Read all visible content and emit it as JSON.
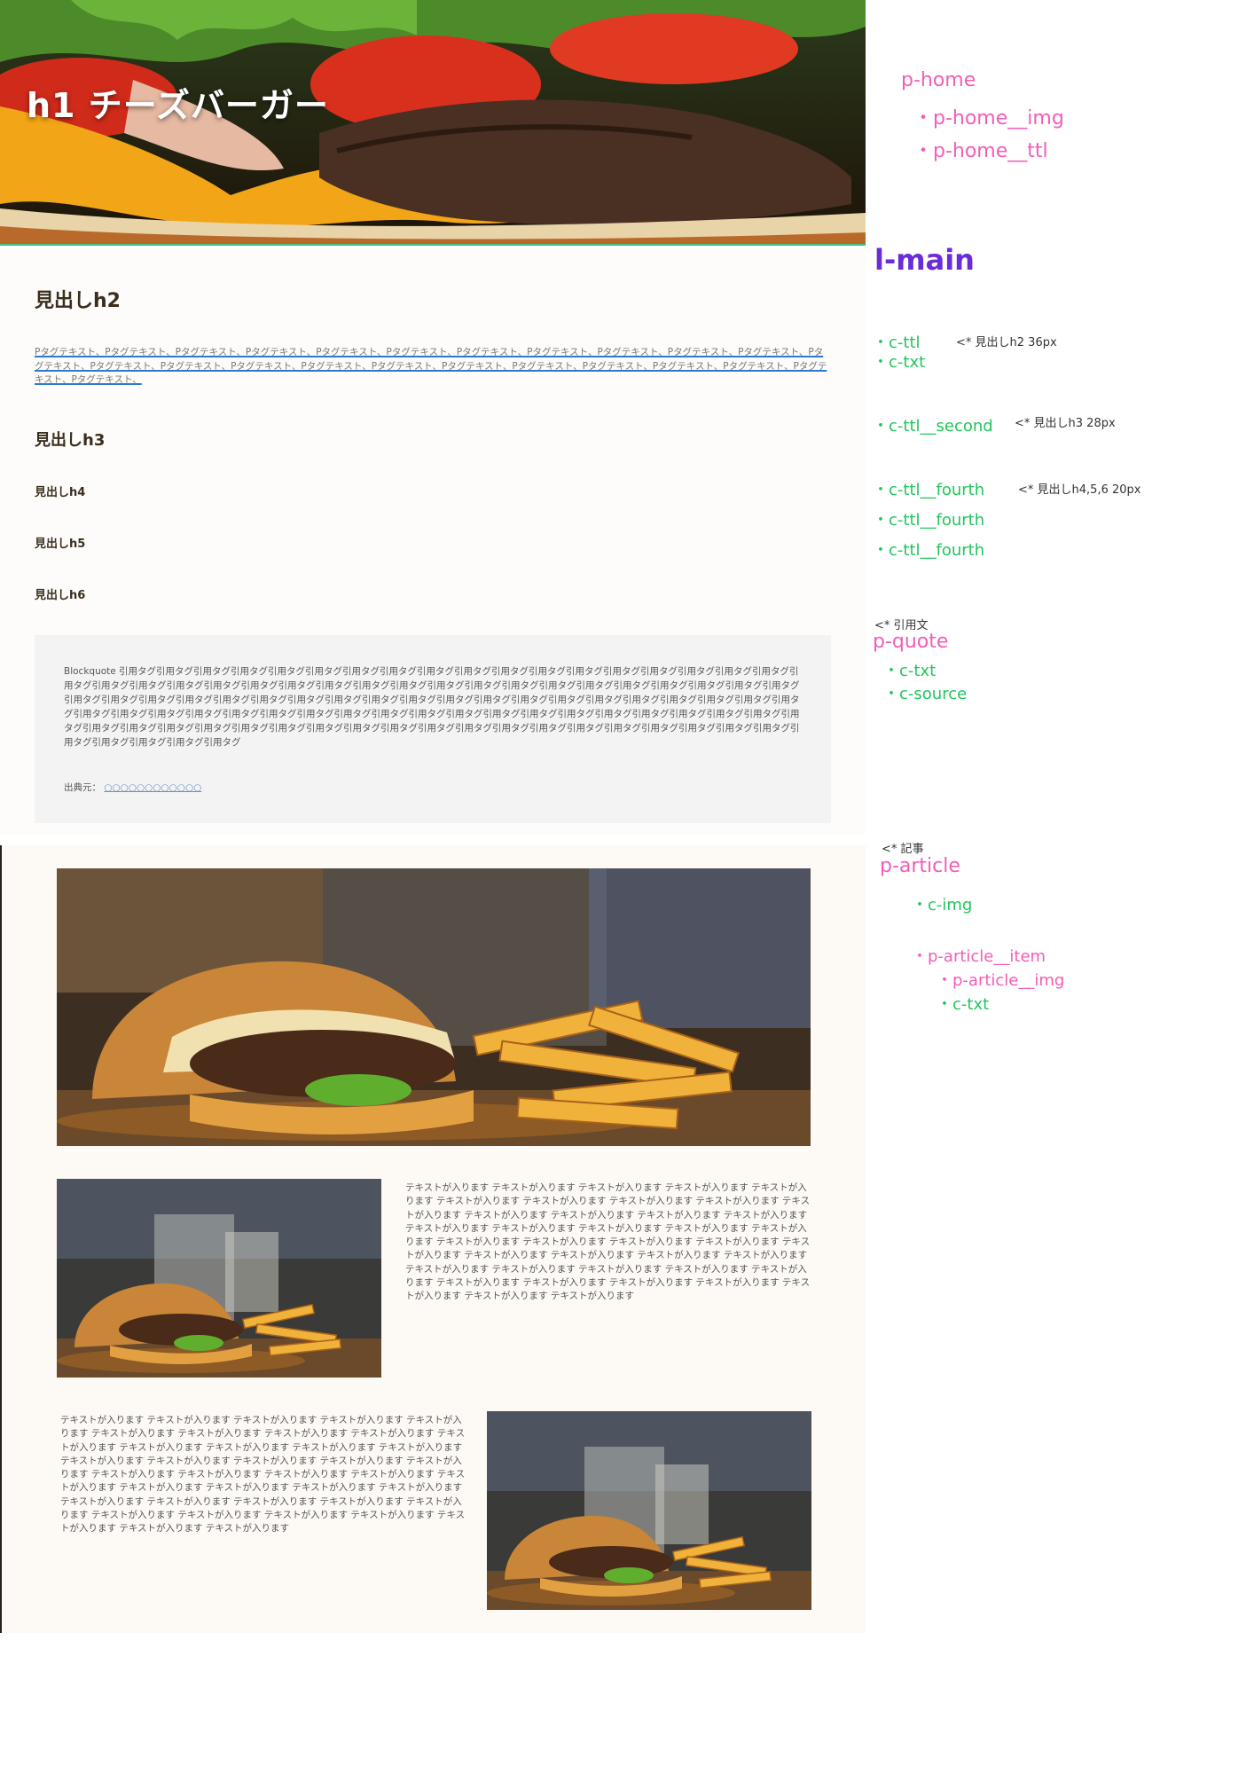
{
  "hero": {
    "title": "h1 チーズバーガー"
  },
  "main": {
    "h2": "見出しh2",
    "link_text": "Pタグテキスト、Pタグテキスト、Pタグテキスト、Pタグテキスト、Pタグテキスト、Pタグテキスト、Pタグテキスト、Pタグテキスト、Pタグテキスト、Pタグテキスト、Pタグテキスト、Pタグテキスト、Pタグテキスト、Pタグテキスト、Pタグテキスト、Pタグテキスト、Pタグテキスト、Pタグテキスト、Pタグテキスト、Pタグテキスト、Pタグテキスト、Pタグテキスト、Pタグテキスト、Pタグテキスト、",
    "h3": "見出しh3",
    "h4": "見出しh4",
    "h5": "見出しh5",
    "h6": "見出しh6",
    "quote_text": "Blockquote 引用タグ引用タグ引用タグ引用タグ引用タグ引用タグ引用タグ引用タグ引用タグ引用タグ引用タグ引用タグ引用タグ引用タグ引用タグ引用タグ引用タグ引用タグ引用タグ引用タグ引用タグ引用タグ引用タグ引用タグ引用タグ引用タグ引用タグ引用タグ引用タグ引用タグ引用タグ引用タグ引用タグ引用タグ引用タグ引用タグ引用タグ引用タグ引用タグ引用タグ引用タグ引用タグ引用タグ引用タグ引用タグ引用タグ引用タグ引用タグ引用タグ引用タグ引用タグ引用タグ引用タグ引用タグ引用タグ引用タグ引用タグ引用タグ引用タグ引用タグ引用タグ引用タグ引用タグ引用タグ引用タグ引用タグ引用タグ引用タグ引用タグ引用タグ引用タグ引用タグ引用タグ引用タグ引用タグ引用タグ引用タグ引用タグ引用タグ引用タグ引用タグ引用タグ引用タグ引用タグ引用タグ引用タグ引用タグ引用タグ引用タグ引用タグ引用タグ引用タグ引用タグ引用タグ引用タグ引用タグ引用タグ引用タグ引用タグ引用タグ引用タグ引用タグ",
    "quote_source_label": "出典元：",
    "quote_source_link": "○○○○○○○○○○○○"
  },
  "article": {
    "text_right": "テキストが入ります テキストが入ります テキストが入ります テキストが入ります テキストが入ります テキストが入ります テキストが入ります テキストが入ります テキストが入ります テキストが入ります テキストが入ります テキストが入ります テキストが入ります テキストが入ります テキストが入ります テキストが入ります テキストが入ります テキストが入ります テキストが入ります テキストが入ります テキストが入ります テキストが入ります テキストが入ります テキストが入ります テキストが入ります テキストが入ります テキストが入ります テキストが入ります テキストが入ります テキストが入ります テキストが入ります テキストが入ります テキストが入ります テキストが入ります テキストが入ります テキストが入ります テキストが入ります テキストが入ります テキストが入ります テキストが入ります",
    "text_left": "テキストが入ります テキストが入ります テキストが入ります テキストが入ります テキストが入ります テキストが入ります テキストが入ります テキストが入ります テキストが入ります テキストが入ります テキストが入ります テキストが入ります テキストが入ります テキストが入ります テキストが入ります テキストが入ります テキストが入ります テキストが入ります テキストが入ります テキストが入ります テキストが入ります テキストが入ります テキストが入ります テキストが入ります テキストが入ります テキストが入ります テキストが入ります テキストが入ります テキストが入ります テキストが入ります テキストが入ります テキストが入ります テキストが入ります テキストが入ります テキストが入ります テキストが入ります テキストが入ります テキストが入ります テキストが入ります テキストが入ります"
  },
  "annotations": {
    "p_home": "p-home",
    "p_home_img": "・p-home__img",
    "p_home_ttl": "・p-home__ttl",
    "l_main": "l-main",
    "c_ttl": "・c-ttl",
    "c_ttl_note": "<* 見出しh2  36px",
    "c_txt": "・c-txt",
    "c_ttl_second": "・c-ttl__second",
    "c_ttl_second_note": "<* 見出しh3  28px",
    "c_ttl_fourth_1": "・c-ttl__fourth",
    "c_ttl_fourth_note": "<* 見出しh4,5,6  20px",
    "c_ttl_fourth_2": "・c-ttl__fourth",
    "c_ttl_fourth_3": "・c-ttl__fourth",
    "quote_note": "<* 引用文",
    "p_quote": "p-quote",
    "quote_c_txt": "・c-txt",
    "quote_c_source": "・c-source",
    "article_note": "<* 記事",
    "p_article": "p-article",
    "c_img": "・c-img",
    "p_article_item": "・p-article__item",
    "p_article_img": "・p-article__img",
    "article_c_txt": "・c-txt"
  },
  "colors": {
    "pink": "#f25db8",
    "green": "#22c55e",
    "purple": "#6a2bd9",
    "link_underline": "#2a7bd0"
  }
}
